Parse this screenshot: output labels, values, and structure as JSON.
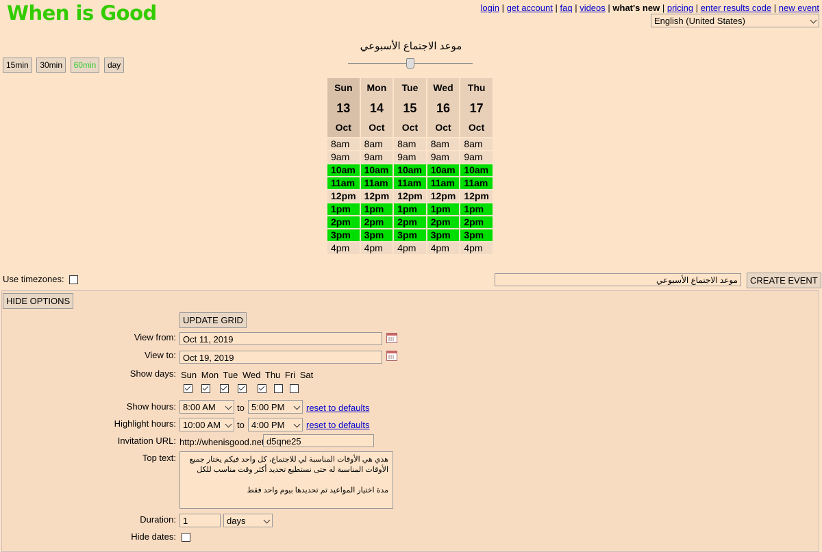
{
  "logo": "When is Good",
  "nav": {
    "links": [
      "login",
      "get account",
      "faq",
      "videos",
      "what's new",
      "pricing",
      "enter results code",
      "new event"
    ]
  },
  "language": "English (United States)",
  "granularity": [
    "15min",
    "30min",
    "60min",
    "day"
  ],
  "event_title": "موعد الاجتماع الأسبوعي",
  "grid": {
    "days": [
      {
        "dow": "Sun",
        "day": "13",
        "mon": "Oct"
      },
      {
        "dow": "Mon",
        "day": "14",
        "mon": "Oct"
      },
      {
        "dow": "Tue",
        "day": "15",
        "mon": "Oct"
      },
      {
        "dow": "Wed",
        "day": "16",
        "mon": "Oct"
      },
      {
        "dow": "Thu",
        "day": "17",
        "mon": "Oct"
      }
    ],
    "hours": [
      "8am",
      "9am",
      "10am",
      "11am",
      "12pm",
      "1pm",
      "2pm",
      "3pm",
      "4pm"
    ],
    "highlight_colors": {
      "selected": "#00dd00"
    }
  },
  "timezones_label": "Use timezones:",
  "create_event_label": "CREATE EVENT",
  "hide_options_label": "HIDE OPTIONS",
  "update_grid_label": "UPDATE GRID",
  "options": {
    "view_from_label": "View from:",
    "view_from": "Oct 11, 2019",
    "view_to_label": "View to:",
    "view_to": "Oct 19, 2019",
    "show_days_label": "Show days:",
    "days": [
      "Sun",
      "Mon",
      "Tue",
      "Wed",
      "Thu",
      "Fri",
      "Sat"
    ],
    "show_hours_label": "Show hours:",
    "show_hours_from": "8:00 AM",
    "show_hours_to": "5:00 PM",
    "highlight_hours_label": "Highlight hours:",
    "highlight_from": "10:00 AM",
    "highlight_to": "4:00 PM",
    "to_label": "to",
    "reset_label": "reset to defaults",
    "invitation_label": "Invitation URL:",
    "invitation_prefix": "http://whenisgood.net/",
    "invitation_code": "d5qne25",
    "top_text_label": "Top text:",
    "top_text": "هذي هي الأوقات المناسبة لي للاجتماع، كل واحد فيكم يختار جميع الأوقات المناسبة له حتى نستطيع تحديد أكثر وقت مناسب للكل\n\nمدة اختيار المواعيد تم تحديدها بيوم واحد فقط",
    "duration_label": "Duration:",
    "duration_value": "1",
    "duration_unit": "days",
    "hide_dates_label": "Hide dates:"
  }
}
